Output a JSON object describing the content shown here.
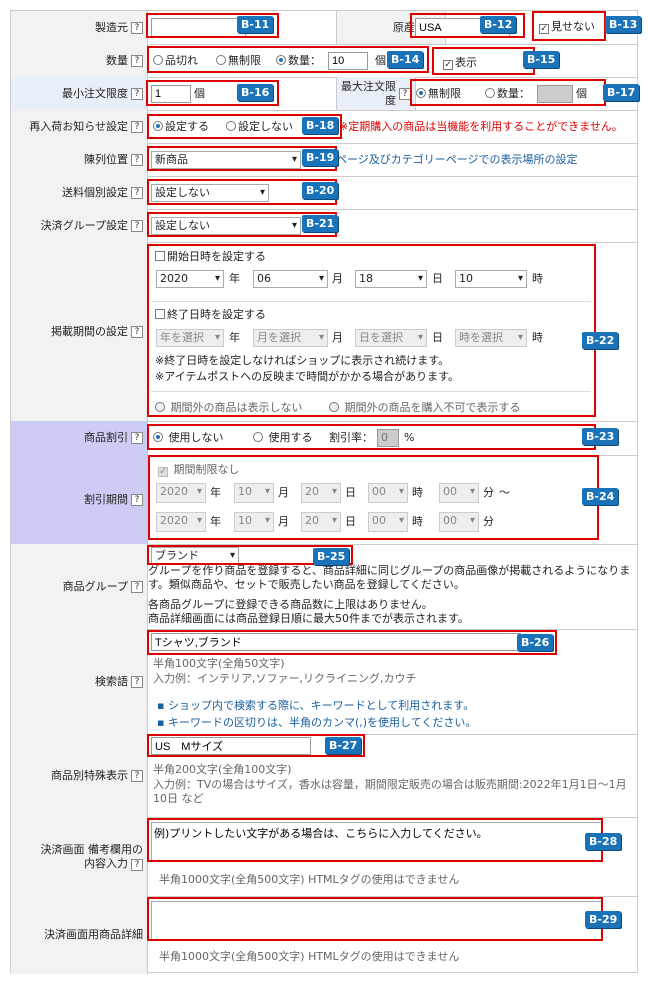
{
  "rows": {
    "maker": {
      "label": "製造元"
    },
    "origin": {
      "label": "原産地",
      "value": "USA",
      "hide_label": "見せない"
    },
    "qty": {
      "label": "数量",
      "opt1": "品切れ",
      "opt2": "無制限",
      "opt3": "数量：",
      "value": "10",
      "unit": "個",
      "show_label": "表示"
    },
    "min_order": {
      "label": "最小注文限度",
      "value": "1",
      "unit": "個"
    },
    "max_order": {
      "label": "最大注文限度",
      "opt1": "無制限",
      "opt2": "数量：",
      "unit": "個"
    },
    "restock": {
      "label": "再入荷お知らせ設定",
      "opt1": "設定する",
      "opt2": "設定しない",
      "note": "※定期購入の商品は当機能を利用することができません。"
    },
    "display_pos": {
      "label": "陳列位置",
      "value": "新商品",
      "note": "ページ及びカテゴリーページでの表示場所の設定"
    },
    "shipping": {
      "label": "送料個別設定",
      "value": "設定しない"
    },
    "payment_group": {
      "label": "決済グループ設定",
      "value": "設定しない"
    },
    "period": {
      "label": "掲載期間の設定",
      "start_label": "開始日時を設定する",
      "year": "2020",
      "month": "06",
      "day": "18",
      "hour": "10",
      "y": "年",
      "m": "月",
      "d": "日",
      "h": "時",
      "end_label": "終了日時を設定する",
      "sel_year": "年を選択",
      "sel_month": "月を選択",
      "sel_day": "日を選択",
      "sel_hour": "時を選択",
      "note1": "※終了日時を設定しなければショップに表示され続けます。",
      "note2": "※アイテムポストへの反映まで時間がかかる場合があります。",
      "opt1": "期間外の商品は表示しない",
      "opt2": "期間外の商品を購入不可で表示する"
    },
    "discount": {
      "label": "商品割引",
      "opt1": "使用しない",
      "opt2": "使用する",
      "rate_label": "割引率：",
      "rate_value": "0",
      "unit": "%"
    },
    "discount_period": {
      "label": "割引期間",
      "nolimit": "期間制限なし",
      "year": "2020",
      "month": "10",
      "day": "20",
      "hour": "00",
      "min": "00",
      "y": "年",
      "m": "月",
      "d": "日",
      "h": "時",
      "mi": "分",
      "tilde": "〜"
    },
    "group": {
      "label": "商品グループ",
      "value": "ブランド",
      "l1": "グループを作り商品を登録すると、商品詳細に同じグループの商品画像が掲載されるようになります。類似商品や、セットで販売したい商品を登録してください。",
      "l2": "各商品グループに登録できる商品数に上限はありません。",
      "l3": "商品詳細画面には商品登録日順に最大50件までが表示されます。"
    },
    "keyword": {
      "label": "検索語",
      "value": "Tシャツ,ブランド",
      "hint1": "半角100文字(全角50文字)",
      "hint2": "入力例：インテリア,ソファー,リクライニング,カウチ",
      "b1": "ショップ内で検索する際に、キーワードとして利用されます。",
      "b2": "キーワードの区切りは、半角のカンマ(,)を使用してください。"
    },
    "special": {
      "label": "商品別特殊表示",
      "value": "US　Mサイズ",
      "hint1": "半角200文字(全角100文字)",
      "hint2": "入力例：TVの場合はサイズ，香水は容量，期間限定販売の場合は販売期間:2022年1月1日〜1月10日 など"
    },
    "memo": {
      "label1": "決済画面 備考欄用の",
      "label2": "内容入力",
      "value": "例)プリントしたい文字がある場合は、こちらに入力してください。",
      "hint": "半角1000文字(全角500文字) HTMLタグの使用はできません"
    },
    "detail": {
      "label": "決済画面用商品詳細",
      "hint": "半角1000文字(全角500文字) HTMLタグの使用はできません"
    }
  },
  "help": "?",
  "badges": [
    "B-11",
    "B-12",
    "B-13",
    "B-14",
    "B-15",
    "B-16",
    "B-17",
    "B-18",
    "B-19",
    "B-20",
    "B-21",
    "B-22",
    "B-23",
    "B-24",
    "B-25",
    "B-26",
    "B-27",
    "B-28",
    "B-29"
  ]
}
